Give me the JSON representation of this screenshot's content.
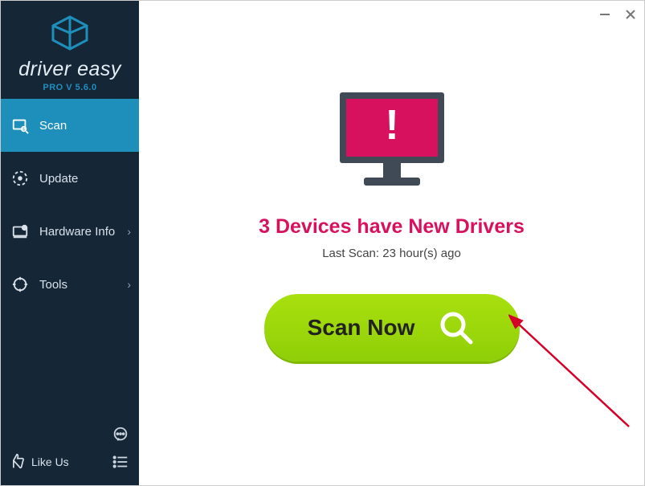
{
  "brand": {
    "name": "driver easy",
    "version": "PRO V 5.6.0"
  },
  "sidebar": {
    "items": [
      {
        "label": "Scan",
        "icon": "scan-icon",
        "active": true,
        "chevron": false
      },
      {
        "label": "Update",
        "icon": "update-icon",
        "active": false,
        "chevron": false
      },
      {
        "label": "Hardware Info",
        "icon": "hardware-icon",
        "active": false,
        "chevron": true
      },
      {
        "label": "Tools",
        "icon": "tools-icon",
        "active": false,
        "chevron": true
      }
    ],
    "like_label": "Like Us"
  },
  "main": {
    "headline": "3 Devices have New Drivers",
    "last_scan": "Last Scan: 23 hour(s) ago",
    "scan_button": "Scan Now"
  },
  "colors": {
    "accent_pink": "#d8115f",
    "scan_green": "#a1dc0b",
    "sidebar_bg": "#152636",
    "sidebar_active": "#1e8fbb"
  }
}
